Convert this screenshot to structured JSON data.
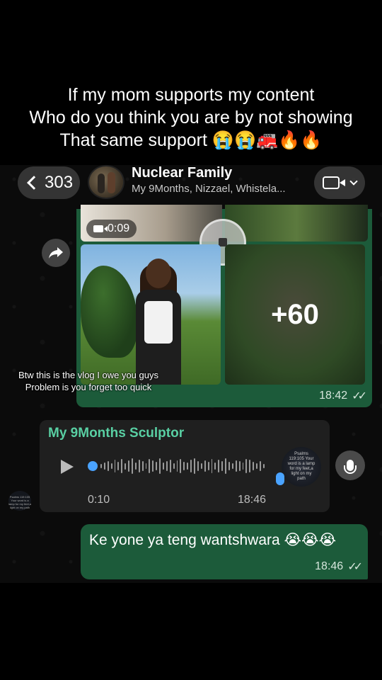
{
  "caption": {
    "line1": "If my mom supports my content",
    "line2": "Who do you think you are by not showing",
    "line3": "That same support 😭😭🚒🔥🔥"
  },
  "header": {
    "back_count": "303",
    "title": "Nuclear Family",
    "subtitle": "My 9Months, Nizzael, Whistela..."
  },
  "media_message": {
    "video_duration": "0:09",
    "more_count": "+60",
    "time": "18:42"
  },
  "overlay_caption": {
    "line1": "Btw this is the vlog I owe you guys",
    "line2": "Problem is you forget too quick"
  },
  "voice_message": {
    "sender": "My 9Months Sculptor",
    "duration": "0:10",
    "time": "18:46",
    "avatar_text": "Psalms 119:105 Your word is a lamp for my feet,a light on my path",
    "wave": [
      6,
      10,
      14,
      8,
      18,
      12,
      20,
      9,
      16,
      22,
      10,
      18,
      14,
      8,
      20,
      16,
      12,
      22,
      10,
      14,
      18,
      8,
      16,
      20,
      12,
      10,
      18,
      22,
      14,
      8,
      16,
      12,
      20,
      10,
      18,
      14,
      22,
      12,
      8,
      16,
      14,
      10,
      20,
      18,
      12,
      8,
      14,
      6
    ]
  },
  "outgoing_message": {
    "text": "Ke yone ya teng wantshwara 😭😭😭",
    "time": "18:46"
  },
  "colors": {
    "outgoing_bubble": "#1c5b3a",
    "incoming_bubble": "#1f1f1f",
    "sender_name": "#59cfa3",
    "accent_blue": "#4aa3ff"
  }
}
